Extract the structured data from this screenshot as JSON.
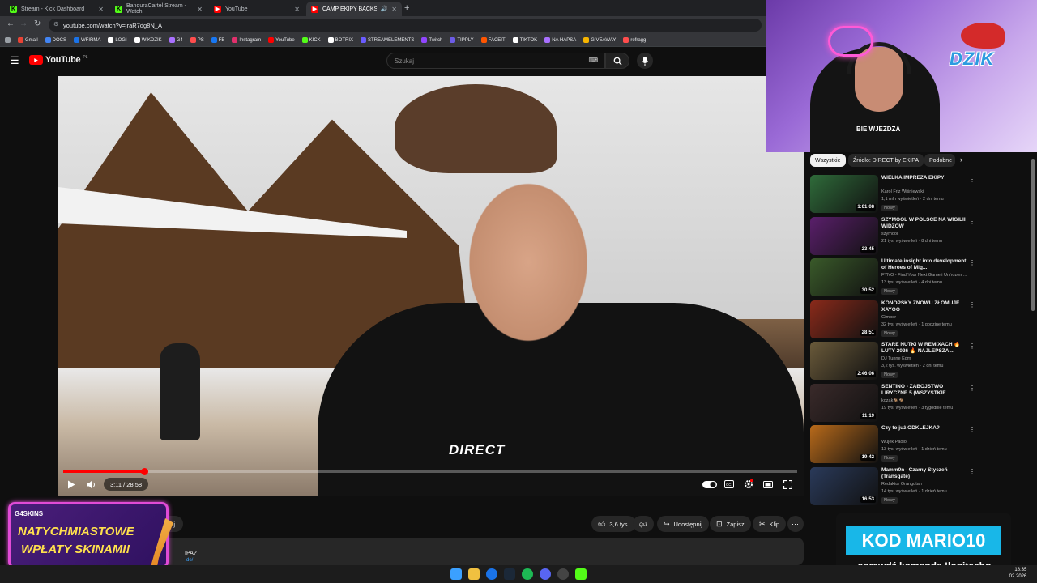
{
  "browser": {
    "tabs": [
      {
        "label": "Stream - Kick Dashboard",
        "icon": "kick-icon",
        "color": "#53fc18"
      },
      {
        "label": "BanduraCartel Stream - Watch",
        "icon": "kick-icon",
        "color": "#53fc18"
      },
      {
        "label": "YouTube",
        "icon": "youtube-icon",
        "color": "#ff0000"
      },
      {
        "label": "CAMP EKIPY BACKSTAGE -",
        "icon": "youtube-icon",
        "color": "#ff0000"
      }
    ],
    "url": "youtube.com/watch?v=jraR7dg8N_A",
    "bookmarks": [
      {
        "label": "Gmail",
        "color": "#ea4335"
      },
      {
        "label": "DOCS",
        "color": "#4285f4"
      },
      {
        "label": "WFIRMA",
        "color": "#1a73e8"
      },
      {
        "label": "LOGI",
        "color": "#ffffff"
      },
      {
        "label": "WIKDZIK",
        "color": "#ffffff"
      },
      {
        "label": "G4",
        "color": "#a970ff"
      },
      {
        "label": "PS",
        "color": "#ff4d4d"
      },
      {
        "label": "FB",
        "color": "#1877f2"
      },
      {
        "label": "Instagram",
        "color": "#e1306c"
      },
      {
        "label": "YouTube",
        "color": "#ff0000"
      },
      {
        "label": "KICK",
        "color": "#53fc18"
      },
      {
        "label": "BOTRIX",
        "color": "#ffffff"
      },
      {
        "label": "STREAMELEMENTS",
        "color": "#6a5cff"
      },
      {
        "label": "Twitch",
        "color": "#9146ff"
      },
      {
        "label": "TIPPLY",
        "color": "#6c5ce7"
      },
      {
        "label": "FACEIT",
        "color": "#ff5500"
      },
      {
        "label": "TIKTOK",
        "color": "#ffffff"
      },
      {
        "label": "NA HAPSA",
        "color": "#a970ff"
      },
      {
        "label": "GIVEAWAY",
        "color": "#f7b500"
      },
      {
        "label": "refragg",
        "color": "#ff4d4d"
      }
    ]
  },
  "youtube": {
    "logo": "YouTube",
    "region": "PL",
    "search_placeholder": "Szukaj"
  },
  "player": {
    "time": "3:11 / 28:58",
    "progress": 0.11,
    "shirt_text": "DIRECT"
  },
  "actions": {
    "like_count": "3,6 tys.",
    "share": "Udostępnij",
    "save": "Zapisz",
    "clip": "Klip",
    "subscribe_partial": "buj",
    "desc_partial_1": "IPA?",
    "desc_partial_2": "de/"
  },
  "filters": [
    "Wszystkie",
    "Źródło: DIRECT by EKIPA",
    "Podobne"
  ],
  "recommendations": [
    {
      "title": "WIELKA IMPREZA EKIPY",
      "channel": "Karol Friz Wiśniewski",
      "meta": "1,1 mln wyświetleń · 2 dni temu",
      "badge": "Nowy",
      "duration": "1:01:08",
      "color": "#2f6b3a"
    },
    {
      "title": "SZYMOOL W POLSCE NA WIGILII WIDZÓW",
      "channel": "szymool",
      "meta": "21 tys. wyświetleń · 8 dni temu",
      "badge": "",
      "duration": "23:45",
      "color": "#5a1f6b"
    },
    {
      "title": "Ultimate insight into development of Heroes of Mig...",
      "channel": "FYNO - Find Your Next Game i Unfrozen ...",
      "meta": "13 tys. wyświetleń · 4 dni temu",
      "badge": "Nowy",
      "duration": "30:52",
      "color": "#3a5a2a"
    },
    {
      "title": "KONOPSKY ZNOWU ZŁOMUJE XAYOO",
      "channel": "Gimper",
      "meta": "32 tys. wyświetleń · 1 godzinę temu",
      "badge": "Nowy",
      "duration": "28:51",
      "color": "#8a2a1a"
    },
    {
      "title": "STARE NUTKI W REMIXACH 🔥 LUTY 2026 🔥 NAJLEPSZA ...",
      "channel": "DJ Tunne Edm",
      "meta": "3,2 tys. wyświetleń · 2 dni temu",
      "badge": "Nowy",
      "duration": "2:46:06",
      "color": "#6a5a3a"
    },
    {
      "title": "SENTINO - ZABÓJSTWO LIRYCZNE 5 (WSZYSTKIE ...",
      "channel": "kozak🐐🐐",
      "meta": "19 tys. wyświetleń · 3 tygodnie temu",
      "badge": "",
      "duration": "11:19",
      "color": "#3a2a2a"
    },
    {
      "title": "Czy to już ODKLEJKA?",
      "channel": "Wujek Paolo",
      "meta": "13 tys. wyświetleń · 1 dzień temu",
      "badge": "Nowy",
      "duration": "19:42",
      "color": "#b86a1a"
    },
    {
      "title": "Mamm0n– Czarny Styczeń (Transgate)",
      "channel": "Redaktor Orangutan",
      "meta": "14 tys. wyświetleń · 1 dzień temu",
      "badge": "Nowy",
      "duration": "16:53",
      "color": "#2a3a5a"
    }
  ],
  "overlay": {
    "webcam_brand": "DZIK",
    "webcam_shirt": "BIE WJEŻDŻA",
    "promo_brand": "G4SKINS",
    "promo_line1": "NATYCHMIASTOWE",
    "promo_line2": "WPŁATY SKINAMI!",
    "code_main": "KOD MARIO10",
    "code_sub": "sprawdź komendę !logitechg"
  },
  "taskbar": {
    "time": "18:35",
    "date": ".02.2026"
  }
}
